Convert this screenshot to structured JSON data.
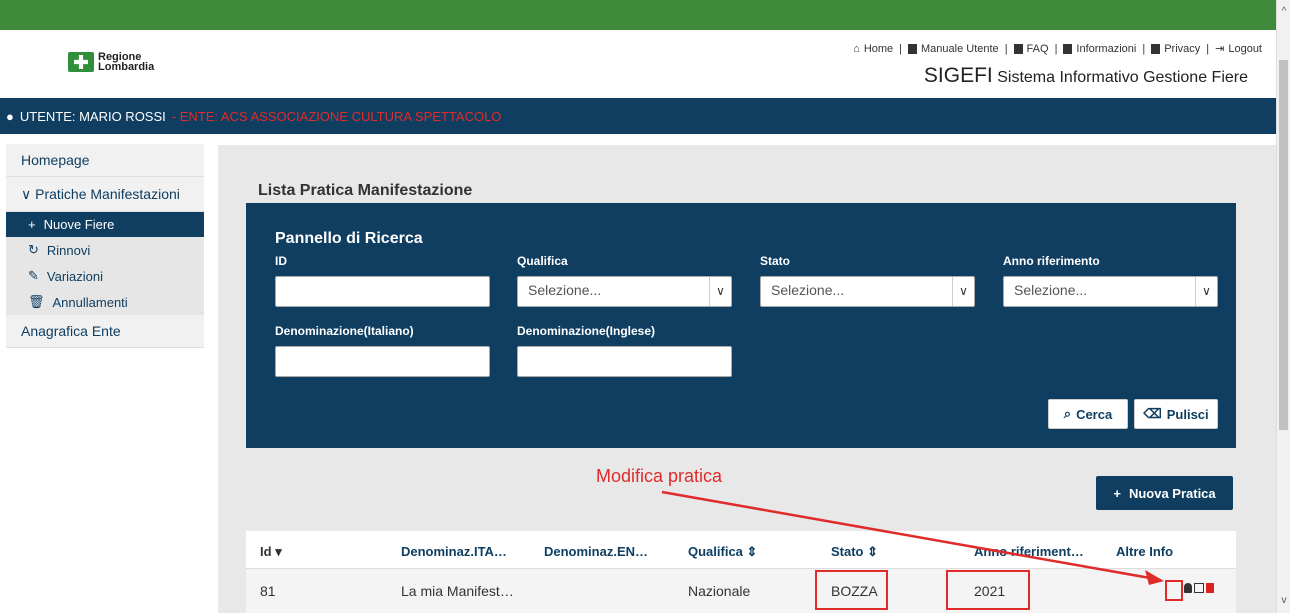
{
  "header": {
    "logo_line1": "Regione",
    "logo_line2": "Lombardia",
    "links": [
      "Home",
      "Manuale Utente",
      "FAQ",
      "Informazioni",
      "Privacy",
      "Logout"
    ],
    "app_short": "SIGEFI",
    "app_long": "Sistema Informativo Gestione Fiere"
  },
  "userbar": {
    "user": "UTENTE: MARIO ROSSI",
    "ente": "- ENTE: ACS ASSOCIAZIONE CULTURA SPETTACOLO"
  },
  "sidebar": {
    "homepage": "Homepage",
    "pratiche": "Pratiche Manifestazioni",
    "items": [
      {
        "icon": "+",
        "label": "Nuove Fiere"
      },
      {
        "icon": "↻",
        "label": "Rinnovi"
      },
      {
        "icon": "✎",
        "label": "Variazioni"
      },
      {
        "icon": "🗑",
        "label": "Annullamenti"
      }
    ],
    "anagrafica": "Anagrafica Ente"
  },
  "main": {
    "title": "Lista Pratica Manifestazione",
    "panel": {
      "title": "Pannello di Ricerca",
      "id_label": "ID",
      "qualifica_label": "Qualifica",
      "stato_label": "Stato",
      "anno_label": "Anno riferimento",
      "select_placeholder": "Selezione...",
      "den_it_label": "Denominazione(Italiano)",
      "den_en_label": "Denominazione(Inglese)",
      "cerca": "Cerca",
      "pulisci": "Pulisci"
    },
    "nuova_pratica": "Nuova Pratica",
    "annotation": "Modifica pratica",
    "table": {
      "headers": [
        "Id",
        "Denominaz.ITA…",
        "Denominaz.EN…",
        "Qualifica",
        "Stato",
        "Anno riferiment…",
        "Altre Info"
      ],
      "row": [
        "81",
        "La mia Manifest…",
        "",
        "Nazionale",
        "BOZZA",
        "2021"
      ]
    }
  },
  "colors": {
    "primary": "#0f3e61",
    "green_bar": "#3f8b3a",
    "annotation_red": "#e02b2b"
  }
}
